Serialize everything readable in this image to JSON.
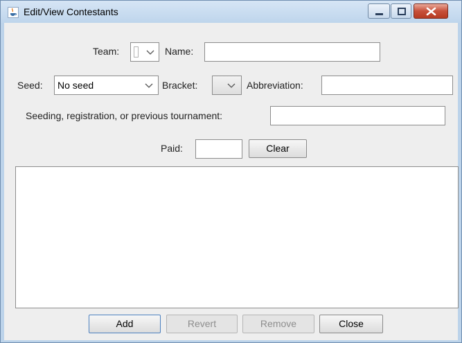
{
  "window": {
    "title": "Edit/View Contestants",
    "icon": "java-cup-icon"
  },
  "form": {
    "team_label": "Team:",
    "team_value": "",
    "name_label": "Name:",
    "name_value": "",
    "seed_label": "Seed:",
    "seed_value": "No seed",
    "bracket_label": "Bracket:",
    "bracket_value": "",
    "abbreviation_label": "Abbreviation:",
    "abbreviation_value": "",
    "seeding_label": "Seeding, registration, or previous tournament:",
    "seeding_value": "",
    "paid_label": "Paid:",
    "paid_value": "",
    "clear_label": "Clear"
  },
  "contestants": [],
  "buttons": {
    "add": "Add",
    "revert": "Revert",
    "remove": "Remove",
    "close": "Close"
  }
}
